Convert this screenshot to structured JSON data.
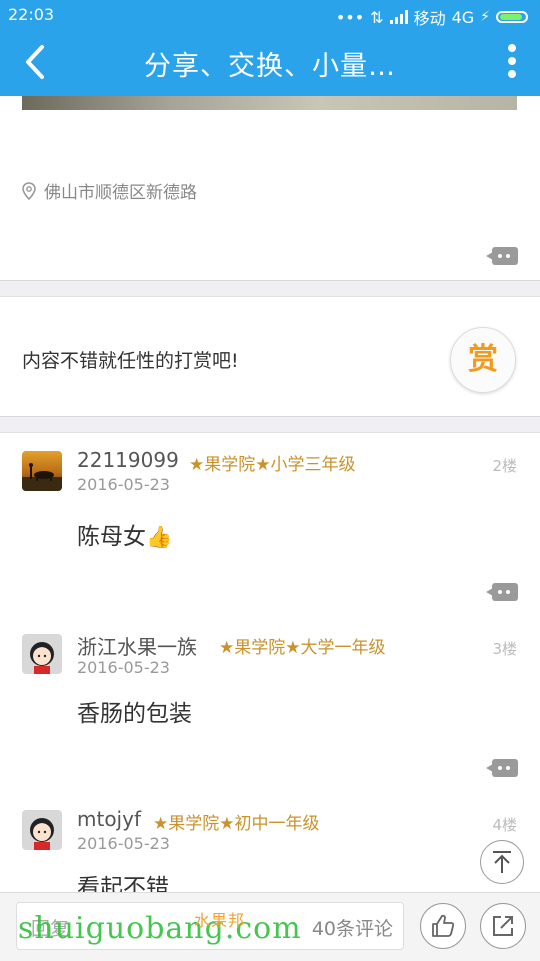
{
  "status": {
    "time": "22:03",
    "carrier": "移动",
    "network": "4G"
  },
  "header": {
    "title": "分享、交换、小量…"
  },
  "post": {
    "location": "佛山市顺德区新德路"
  },
  "reward": {
    "text": "内容不错就任性的打赏吧!",
    "button_label": "赏"
  },
  "comments": [
    {
      "username": "22119099",
      "level": "★果学院★小学三年级",
      "date": "2016-05-23",
      "floor": "2楼",
      "text": "陈母女"
    },
    {
      "username": "浙江水果一族",
      "level": "★果学院★大学一年级",
      "date": "2016-05-23",
      "floor": "3楼",
      "text": "香肠的包装"
    },
    {
      "username": "mtojyf",
      "level": "★果学院★初中一年级",
      "date": "2016-05-23",
      "floor": "4楼",
      "text": "看起不错"
    }
  ],
  "bottom": {
    "placeholder": "回复",
    "comment_count": "40条评论"
  },
  "watermark": {
    "text": "shuiguobang.com",
    "logo_text": "水果邦"
  },
  "colors": {
    "header": "#2aa3ea",
    "level": "#c9922b",
    "reward": "#f39a1b"
  }
}
